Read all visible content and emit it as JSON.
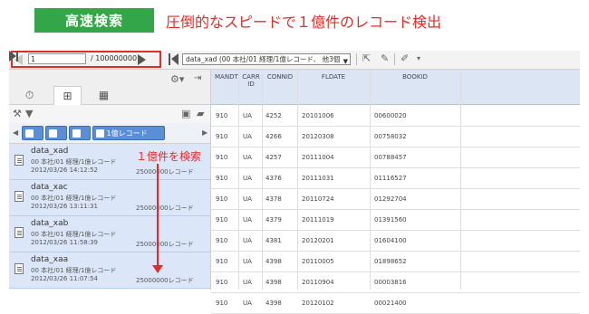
{
  "header": {
    "badge": "高速検索",
    "caption": "圧倒的なスピードで１億件のレコード検出"
  },
  "toolbar": {
    "page_value": "1",
    "page_total": "/ 100000000",
    "dataset_select": "data_xad (00 本社/01 経理/1億レコード、 他3個"
  },
  "breadcrumb": {
    "last_label": "1億レコード"
  },
  "annotation": {
    "label": "１億件を検索"
  },
  "items": [
    {
      "name": "data_xad",
      "desc": "00 本社/01 経理/1億レコード",
      "date": "2012/03/26 14:12:52",
      "count": "25000000レコード"
    },
    {
      "name": "data_xac",
      "desc": "00 本社/01 経理/1億レコード",
      "date": "2012/03/26 13:11:31",
      "count": "25000000レコード"
    },
    {
      "name": "data_xab",
      "desc": "00 本社/01 経理/1億レコード",
      "date": "2012/03/26 11:58:39",
      "count": "25000000レコード"
    },
    {
      "name": "data_xaa",
      "desc": "00 本社/01 経理/1億レコード",
      "date": "2012/03/26 11:07:54",
      "count": "25000000レコード"
    }
  ],
  "grid": {
    "columns": [
      "MANDT",
      "CARR ID",
      "CONNID",
      "FLDATE",
      "BOOKID"
    ],
    "rows": [
      [
        "910",
        "UA",
        "4252",
        "20101006",
        "00600020"
      ],
      [
        "910",
        "UA",
        "4266",
        "20120308",
        "00758032"
      ],
      [
        "910",
        "UA",
        "4257",
        "20111004",
        "00788457"
      ],
      [
        "910",
        "UA",
        "4376",
        "20111031",
        "01116527"
      ],
      [
        "910",
        "UA",
        "4378",
        "20110724",
        "01292704"
      ],
      [
        "910",
        "UA",
        "4379",
        "20111019",
        "01391560"
      ],
      [
        "910",
        "UA",
        "4381",
        "20120201",
        "01604100"
      ],
      [
        "910",
        "UA",
        "4398",
        "20110005",
        "01898652"
      ],
      [
        "910",
        "UA",
        "4398",
        "20110904",
        "00003816"
      ],
      [
        "910",
        "UA",
        "4398",
        "20120102",
        "00021400"
      ]
    ]
  }
}
